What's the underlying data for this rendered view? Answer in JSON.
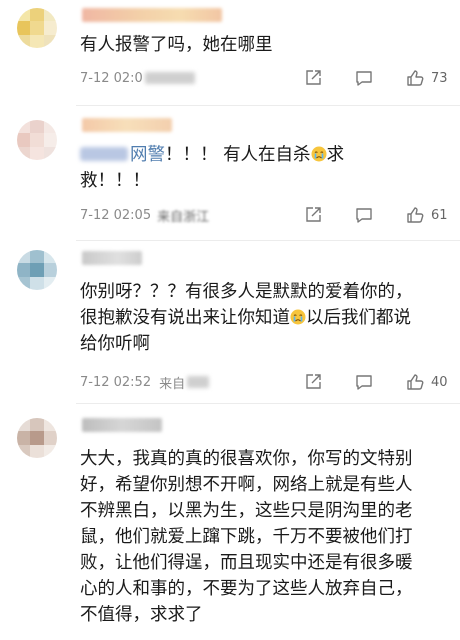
{
  "comments": [
    {
      "text": "有人报警了吗，她在哪里",
      "time": "7-12 02:0",
      "likes": "73"
    },
    {
      "mention": "网警",
      "text_line1_rest": "！！！ 有人在自杀",
      "text_line1_end": "求",
      "text_line2": "救！！！",
      "time": "7-12 02:05",
      "location": "来自浙江",
      "likes": "61"
    },
    {
      "text_line1": "你别呀？？？有很多人是默默的爱着你的，",
      "text_line2a": "很抱歉没有说出来让你知道",
      "text_line2b": "以后我们都说",
      "text_line3": "给你听啊",
      "time": "7-12 02:52",
      "location": "来自",
      "likes": "40"
    },
    {
      "text": "大大，我真的真的很喜欢你，你写的文特别\n好，希望你别想不开啊，网络上就是有些人\n不辨黑白，以黑为生，这些只是阴沟里的老\n鼠，他们就爱上蹿下跳，千万不要被他们打\n败，让他们得逞，而且现实中还是有很多暖\n心的人和事的，不要为了这些人放弃自己，\n不值得，求求了"
    }
  ],
  "icons": {
    "share": "share-icon",
    "comment": "comment-icon",
    "like": "thumbs-up-icon",
    "emoji": "crying-face-emoji"
  },
  "colors": {
    "mention": "#507daf",
    "meta": "#8a8a8a"
  }
}
